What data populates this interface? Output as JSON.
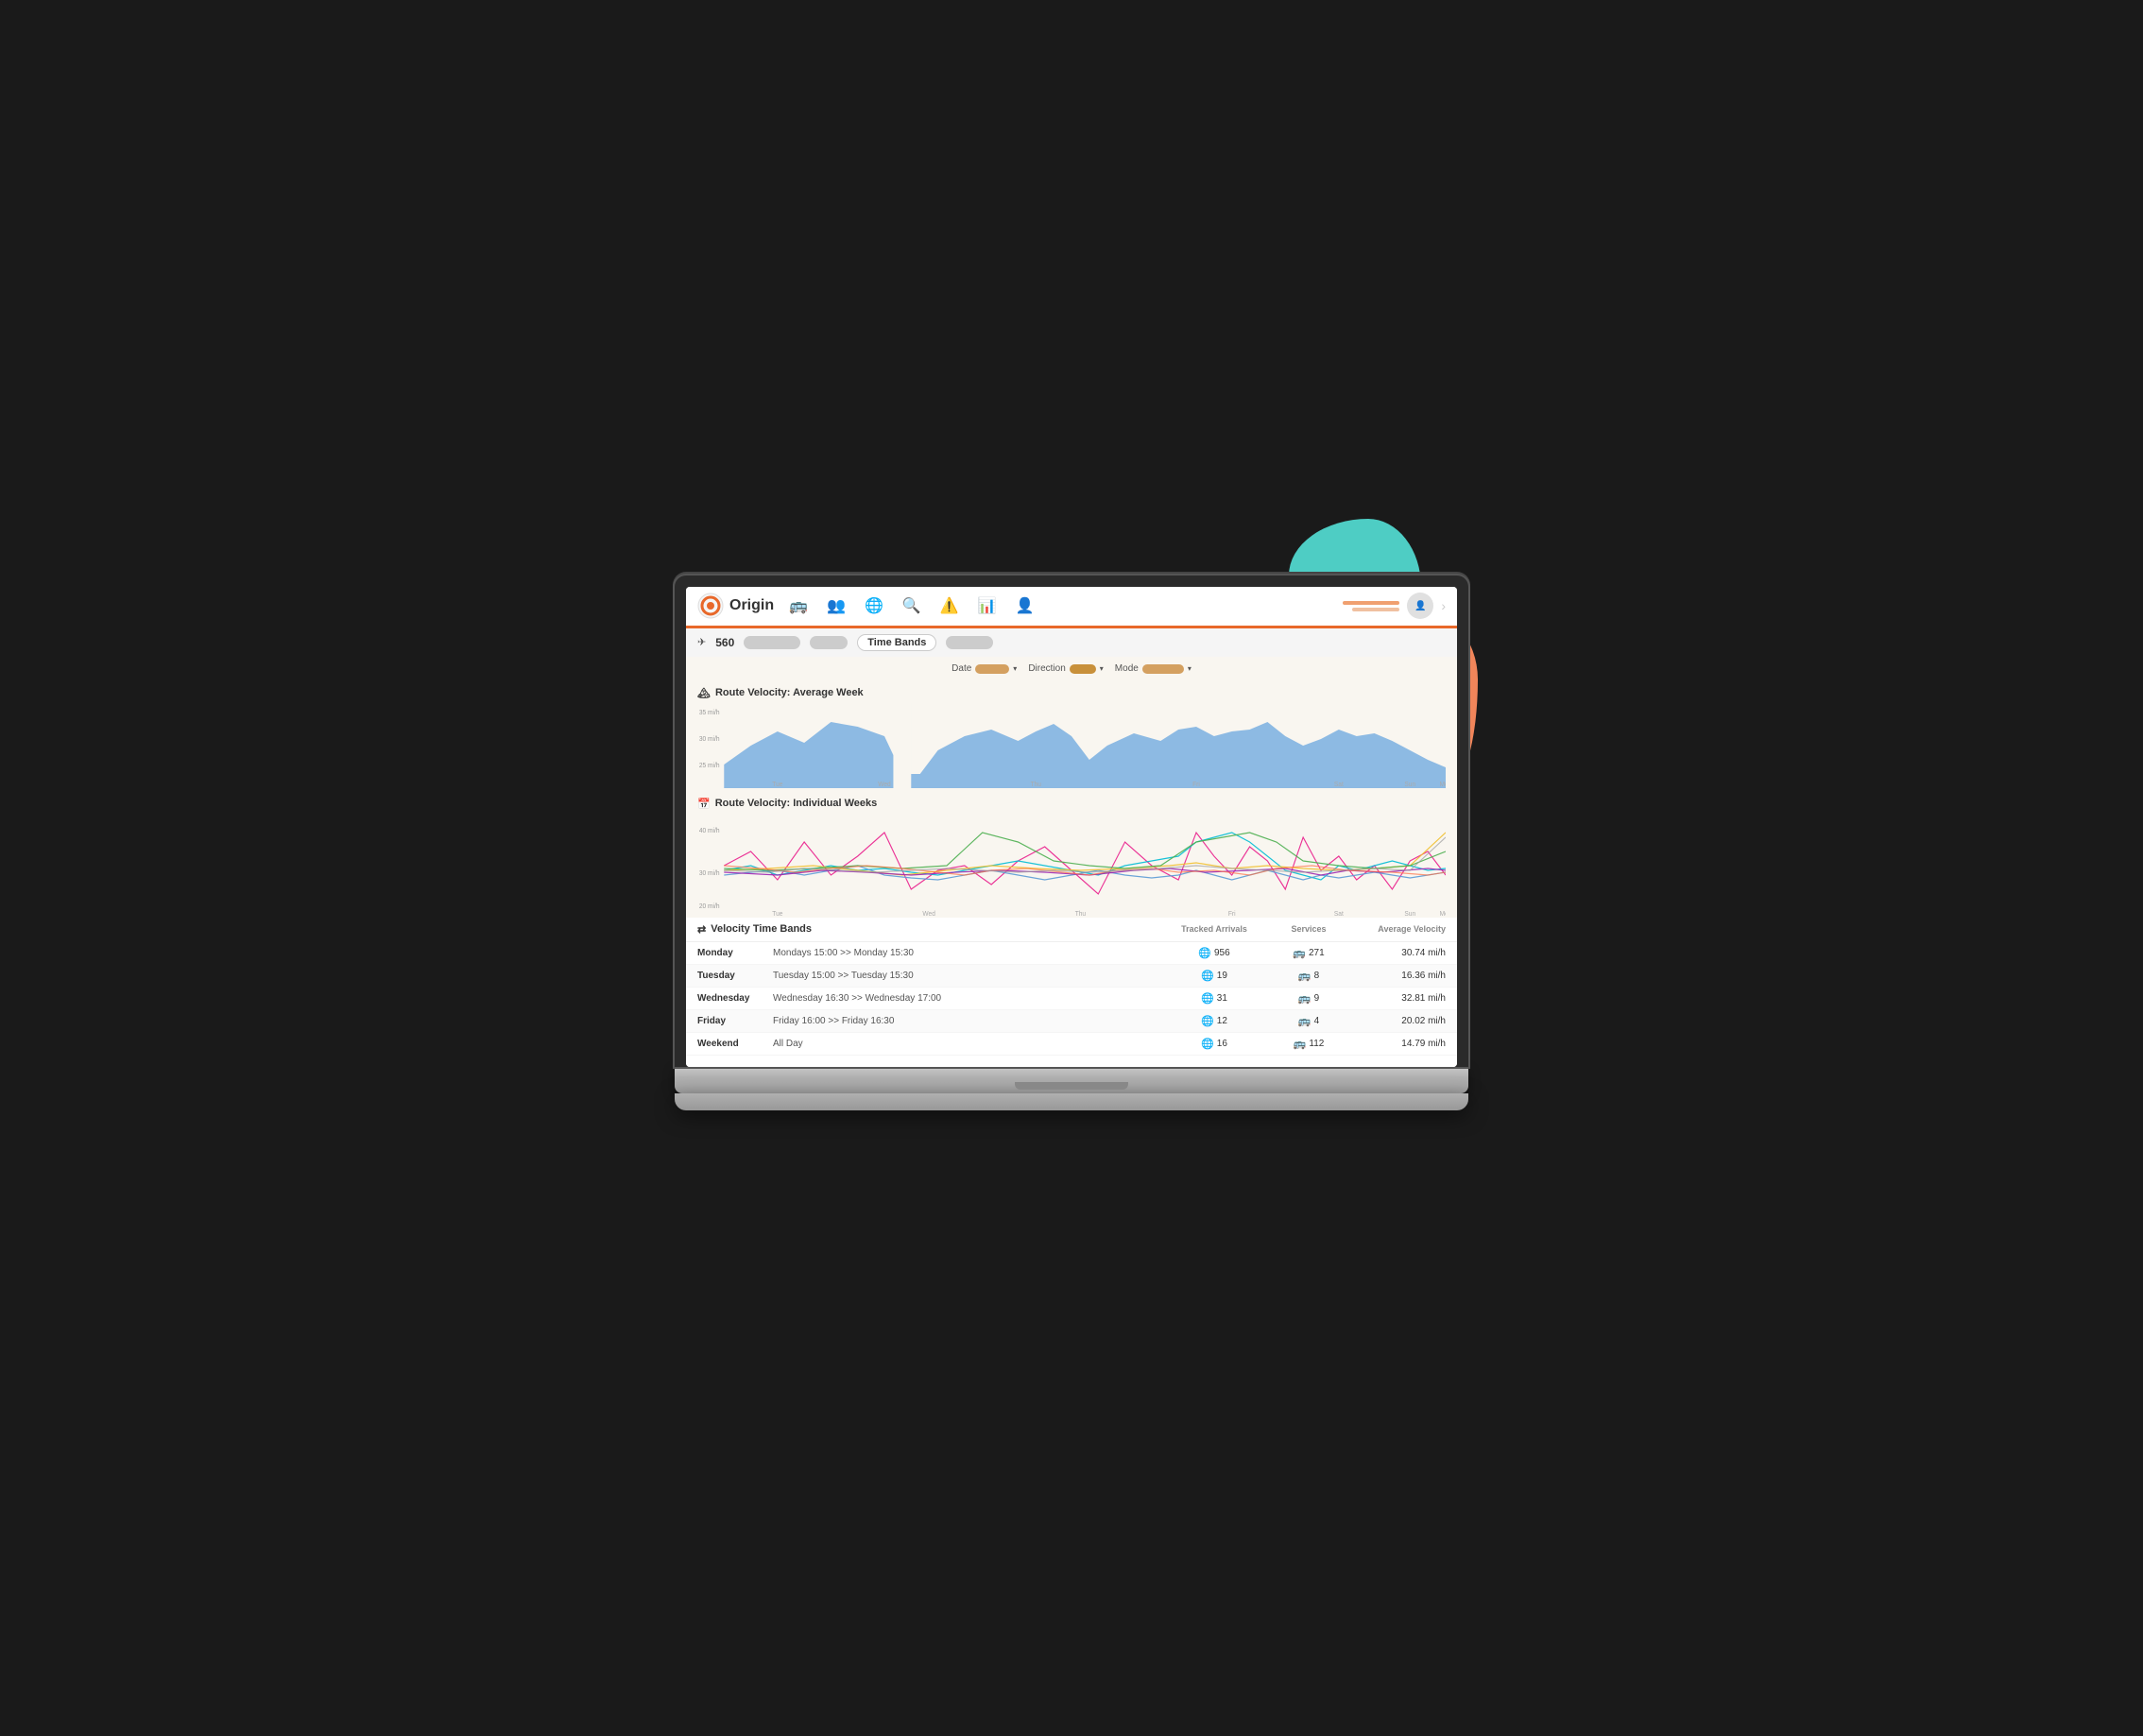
{
  "app": {
    "logo_text": "Origin",
    "nav_items": [
      "bus",
      "people",
      "globe",
      "search",
      "alert",
      "chart",
      "group"
    ],
    "route_number": "560",
    "route_bar_label": "Time Bands"
  },
  "filters": {
    "date_label": "Date",
    "direction_label": "Direction",
    "mode_label": "Mode"
  },
  "avg_week_chart": {
    "title": "Route Velocity: Average Week"
  },
  "ind_weeks_chart": {
    "title": "Route Velocity: Individual Weeks"
  },
  "velocity_table": {
    "title": "Velocity Time Bands",
    "col_tracked": "Tracked Arrivals",
    "col_services": "Services",
    "col_velocity": "Average Velocity",
    "rows": [
      {
        "day": "Monday",
        "time": "Mondays 15:00 >> Monday 15:30",
        "tracked": "956",
        "services": "271",
        "velocity": "30.74 mi/h"
      },
      {
        "day": "Tuesday",
        "time": "Tuesday 15:00 >> Tuesday 15:30",
        "tracked": "19",
        "services": "8",
        "velocity": "16.36 mi/h"
      },
      {
        "day": "Wednesday",
        "time": "Wednesday 16:30 >> Wednesday 17:00",
        "tracked": "31",
        "services": "9",
        "velocity": "32.81 mi/h"
      },
      {
        "day": "Friday",
        "time": "Friday 16:00 >> Friday 16:30",
        "tracked": "12",
        "services": "4",
        "velocity": "20.02 mi/h"
      },
      {
        "day": "Weekend",
        "time": "All Day",
        "tracked": "16",
        "services": "112",
        "velocity": "14.79 mi/h"
      }
    ]
  }
}
